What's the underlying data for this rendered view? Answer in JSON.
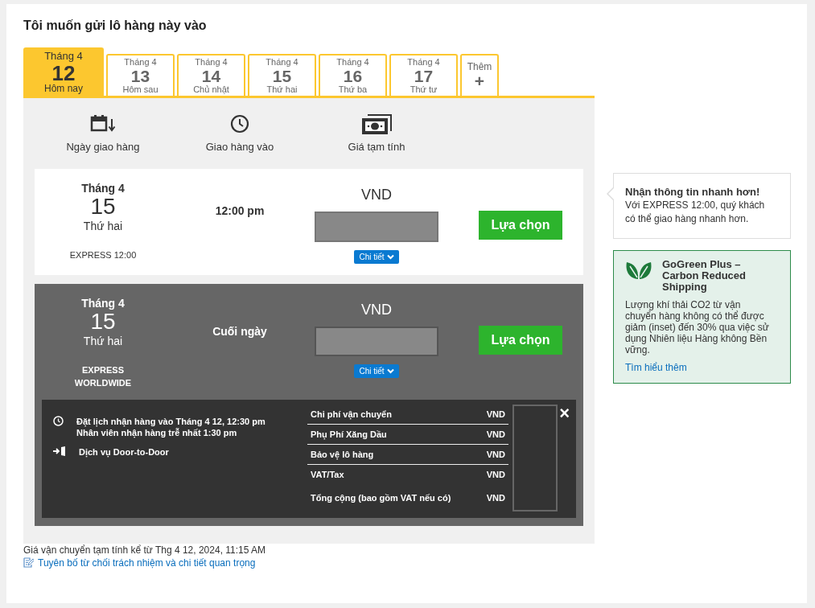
{
  "title": "Tôi muốn gửi lô hàng này vào",
  "tabs": [
    {
      "month": "Tháng 4",
      "day": "12",
      "label": "Hôm nay",
      "selected": true
    },
    {
      "month": "Tháng 4",
      "day": "13",
      "label": "Hôm sau",
      "selected": false
    },
    {
      "month": "Tháng 4",
      "day": "14",
      "label": "Chủ nhật",
      "selected": false
    },
    {
      "month": "Tháng 4",
      "day": "15",
      "label": "Thứ hai",
      "selected": false
    },
    {
      "month": "Tháng 4",
      "day": "16",
      "label": "Thứ ba",
      "selected": false
    },
    {
      "month": "Tháng 4",
      "day": "17",
      "label": "Thứ tư",
      "selected": false
    },
    {
      "kind": "more",
      "month": "Thêm",
      "day": "+",
      "selected": false
    }
  ],
  "headers": [
    {
      "kind": "calendar",
      "label": "Ngày giao hàng"
    },
    {
      "kind": "clock",
      "label": "Giao hàng vào"
    },
    {
      "kind": "money",
      "label": "Giá tạm tính"
    }
  ],
  "options": [
    {
      "month": "Tháng 4",
      "day": "15",
      "weekday": "Thứ hai",
      "service": "EXPRESS 12:00",
      "time": "12:00 pm",
      "currency": "VND",
      "details_button": "Chi tiết",
      "select_button": "Lựa chọn",
      "selected": false
    },
    {
      "month": "Tháng 4",
      "day": "15",
      "weekday": "Thứ hai",
      "service": "EXPRESS WORLDWIDE",
      "time": "Cuối ngày",
      "currency": "VND",
      "details_button": "Chi tiết",
      "select_button": "Lựa chọn",
      "selected": true,
      "details": {
        "pickup": [
          "Đặt lịch nhận hàng vào Tháng 4 12, 12:30 pm",
          "Nhân viên nhận hàng trễ nhất 1:30 pm"
        ],
        "service": "Dịch vụ Door-to-Door",
        "close": "×",
        "charges": [
          {
            "label": "Chi phí vận chuyển",
            "currency": "VND"
          },
          {
            "label": "Phụ Phí Xăng Dầu",
            "currency": "VND"
          },
          {
            "label": "Bảo vệ lô hàng",
            "currency": "VND"
          },
          {
            "label": "VAT/Tax",
            "currency": "VND"
          },
          {
            "kind": "total",
            "label": "Tổng cộng (bao gồm VAT nếu có)",
            "currency": "VND"
          }
        ]
      }
    }
  ],
  "tip": {
    "title": "Nhận thông tin nhanh hơn!",
    "text": "Với EXPRESS 12:00, quý khách có thể giao hàng nhanh hơn."
  },
  "gogreen": {
    "title": "GoGreen Plus – Carbon Reduced Shipping",
    "text": "Lượng khí thải CO2 từ vận chuyển hàng không có thể được giảm (inset) đến 30% qua việc sử dụng Nhiên liệu Hàng không Bền vững.",
    "link": "Tìm hiểu thêm"
  },
  "footer": {
    "note": "Giá vận chuyển tạm tính kể từ Thg 4 12, 2024, 11:15 AM",
    "link": "Tuyên bố từ chối trách nhiệm và chi tiết quan trọng"
  }
}
